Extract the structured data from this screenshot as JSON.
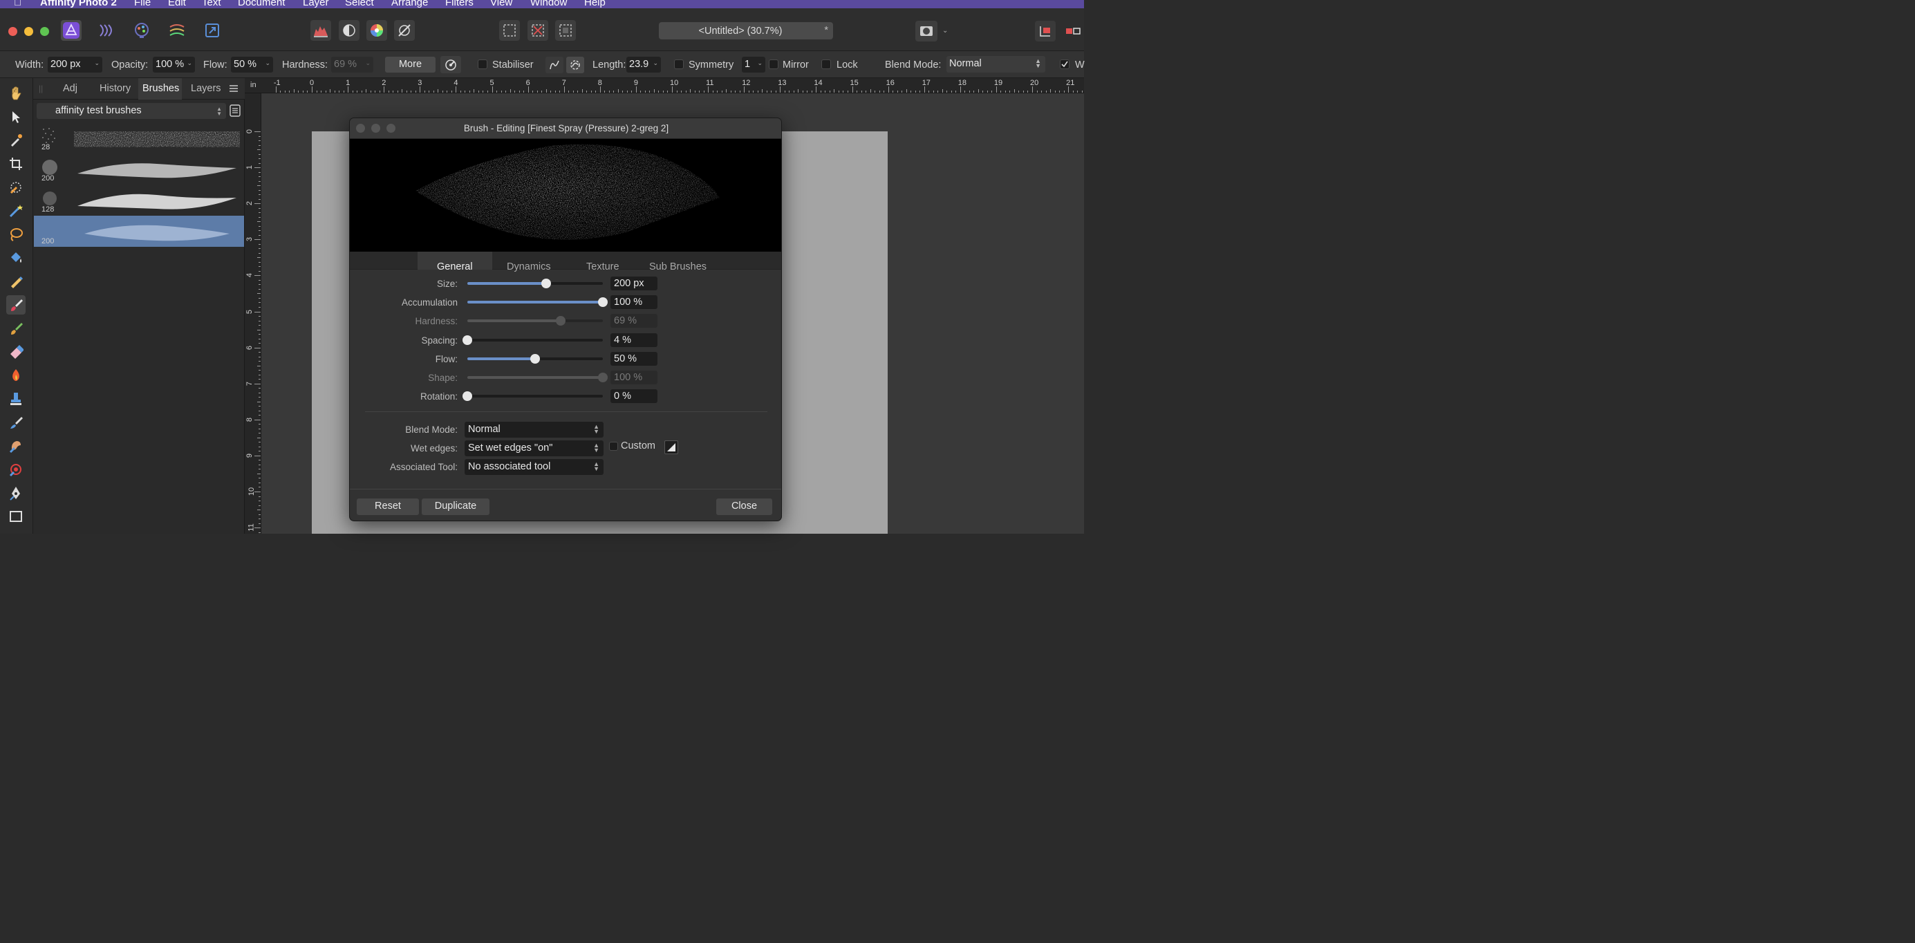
{
  "menubar": {
    "app_name": "Affinity Photo 2",
    "items": [
      "File",
      "Edit",
      "Text",
      "Document",
      "Layer",
      "Select",
      "Arrange",
      "Filters",
      "View",
      "Window",
      "Help"
    ]
  },
  "titlebar": {
    "personas": [
      "photo-persona-icon",
      "liquify-persona-icon",
      "develop-persona-icon",
      "tone-mapping-persona-icon",
      "export-persona-icon"
    ],
    "document_title": "<Untitled> (30.7%)",
    "modified_mark": "*"
  },
  "context": {
    "width_label": "Width:",
    "width_value": "200 px",
    "opacity_label": "Opacity:",
    "opacity_value": "100 %",
    "flow_label": "Flow:",
    "flow_value": "50 %",
    "hardness_label": "Hardness:",
    "hardness_value": "69 %",
    "more_label": "More",
    "stabiliser_label": "Stabiliser",
    "length_label": "Length:",
    "length_value": "23.9",
    "symmetry_label": "Symmetry",
    "symmetry_value": "1",
    "mirror_label": "Mirror",
    "lock_label": "Lock",
    "blend_mode_label": "Blend Mode:",
    "blend_mode_value": "Normal",
    "wrap_label": "W"
  },
  "tools": [
    "hand-tool-icon",
    "move-tool-icon",
    "color-picker-tool-icon",
    "crop-tool-icon",
    "selection-brush-tool-icon",
    "flood-select-tool-icon",
    "freehand-selection-tool-icon",
    "fill-tool-icon",
    "pixel-tool-icon",
    "paint-brush-tool-icon",
    "color-replacement-tool-icon",
    "erase-tool-icon",
    "dodge-tool-icon",
    "clone-tool-icon",
    "smudge-tool-icon",
    "healing-tool-icon",
    "red-eye-tool-icon",
    "pen-tool-icon",
    "rectangle-tool-icon"
  ],
  "panel": {
    "tabs": [
      "Adj",
      "History",
      "Brushes",
      "Layers"
    ],
    "active_tab": "Brushes",
    "category": "affinity test brushes",
    "brushes": [
      {
        "size": "28"
      },
      {
        "size": "200"
      },
      {
        "size": "128"
      },
      {
        "size": "200",
        "selected": true
      }
    ]
  },
  "ruler": {
    "unit": "in",
    "h_ticks": [
      "-1",
      "0",
      "1",
      "2",
      "3",
      "4",
      "5",
      "6",
      "7",
      "8",
      "9",
      "10",
      "11",
      "12",
      "13",
      "14",
      "15",
      "16",
      "17",
      "18",
      "19",
      "20",
      "21"
    ],
    "v_ticks": [
      "0",
      "1",
      "2",
      "3",
      "4",
      "5",
      "6",
      "7",
      "8",
      "9",
      "10",
      "11"
    ]
  },
  "dialog": {
    "title": "Brush - Editing [Finest Spray (Pressure) 2-greg 2]",
    "tabs": [
      "General",
      "Dynamics",
      "Texture",
      "Sub Brushes"
    ],
    "active_tab": "General",
    "params": [
      {
        "label": "Size:",
        "value": "200 px",
        "fraction": 0.58,
        "enabled": true
      },
      {
        "label": "Accumulation",
        "value": "100 %",
        "fraction": 1.0,
        "enabled": true
      },
      {
        "label": "Hardness:",
        "value": "69 %",
        "fraction": 0.69,
        "enabled": false
      },
      {
        "label": "Spacing:",
        "value": "4 %",
        "fraction": 0.0,
        "enabled": true
      },
      {
        "label": "Flow:",
        "value": "50 %",
        "fraction": 0.5,
        "enabled": true
      },
      {
        "label": "Shape:",
        "value": "100 %",
        "fraction": 1.0,
        "enabled": false
      },
      {
        "label": "Rotation:",
        "value": "0 %",
        "fraction": 0.0,
        "enabled": true
      }
    ],
    "blend_mode_label": "Blend Mode:",
    "blend_mode_value": "Normal",
    "wet_edges_label": "Wet edges:",
    "wet_edges_value": "Set wet edges \"on\"",
    "custom_label": "Custom",
    "associated_tool_label": "Associated Tool:",
    "associated_tool_value": "No associated tool",
    "reset_label": "Reset",
    "duplicate_label": "Duplicate",
    "close_label": "Close"
  },
  "colors": {
    "accent": "#6a8fc8",
    "menubar": "#5a4a9e",
    "selected_brush": "#5d7ca8"
  }
}
